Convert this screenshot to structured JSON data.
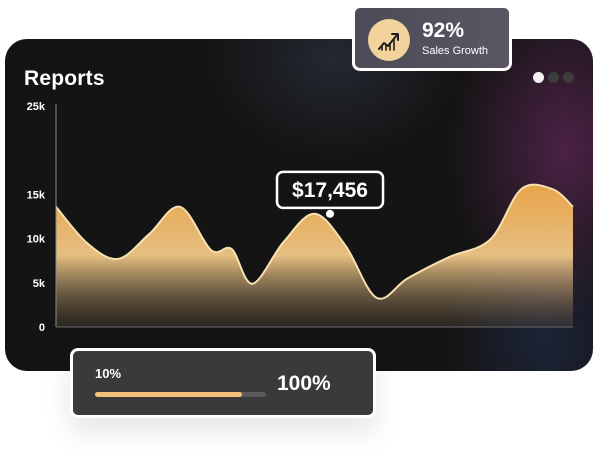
{
  "card": {
    "title": "Reports"
  },
  "carousel": {
    "dots": 3,
    "active_index": 0
  },
  "growth": {
    "value": "92%",
    "label": "Sales Growth",
    "icon": "trend-up-icon"
  },
  "progress": {
    "start_label": "10%",
    "end_label": "100%",
    "fill_fraction": 0.86
  },
  "colors": {
    "background": "#141414",
    "area_top": "#f0c787",
    "line": "#f8e0b0",
    "accent": "#f4d29c"
  },
  "chart_data": {
    "type": "area",
    "title": "",
    "xlabel": "",
    "ylabel": "",
    "ylim": [
      0,
      25000
    ],
    "y_ticks": [
      "0",
      "5k",
      "10k",
      "15k",
      "25k"
    ],
    "y_tick_values": [
      0,
      5000,
      10000,
      15000,
      25000
    ],
    "grid": false,
    "x": [
      0,
      3,
      6,
      9,
      12,
      15,
      17,
      19,
      22,
      25,
      28,
      31,
      34,
      38,
      42,
      45,
      48,
      50
    ],
    "series": [
      {
        "values": [
          13600,
          9500,
          7700,
          10500,
          13600,
          8700,
          8800,
          4900,
          9600,
          12800,
          9200,
          3300,
          5500,
          7900,
          9900,
          15600,
          15600,
          13600
        ]
      }
    ],
    "annotation": {
      "x": 26.5,
      "value": 12800,
      "label": "$17,456"
    }
  }
}
